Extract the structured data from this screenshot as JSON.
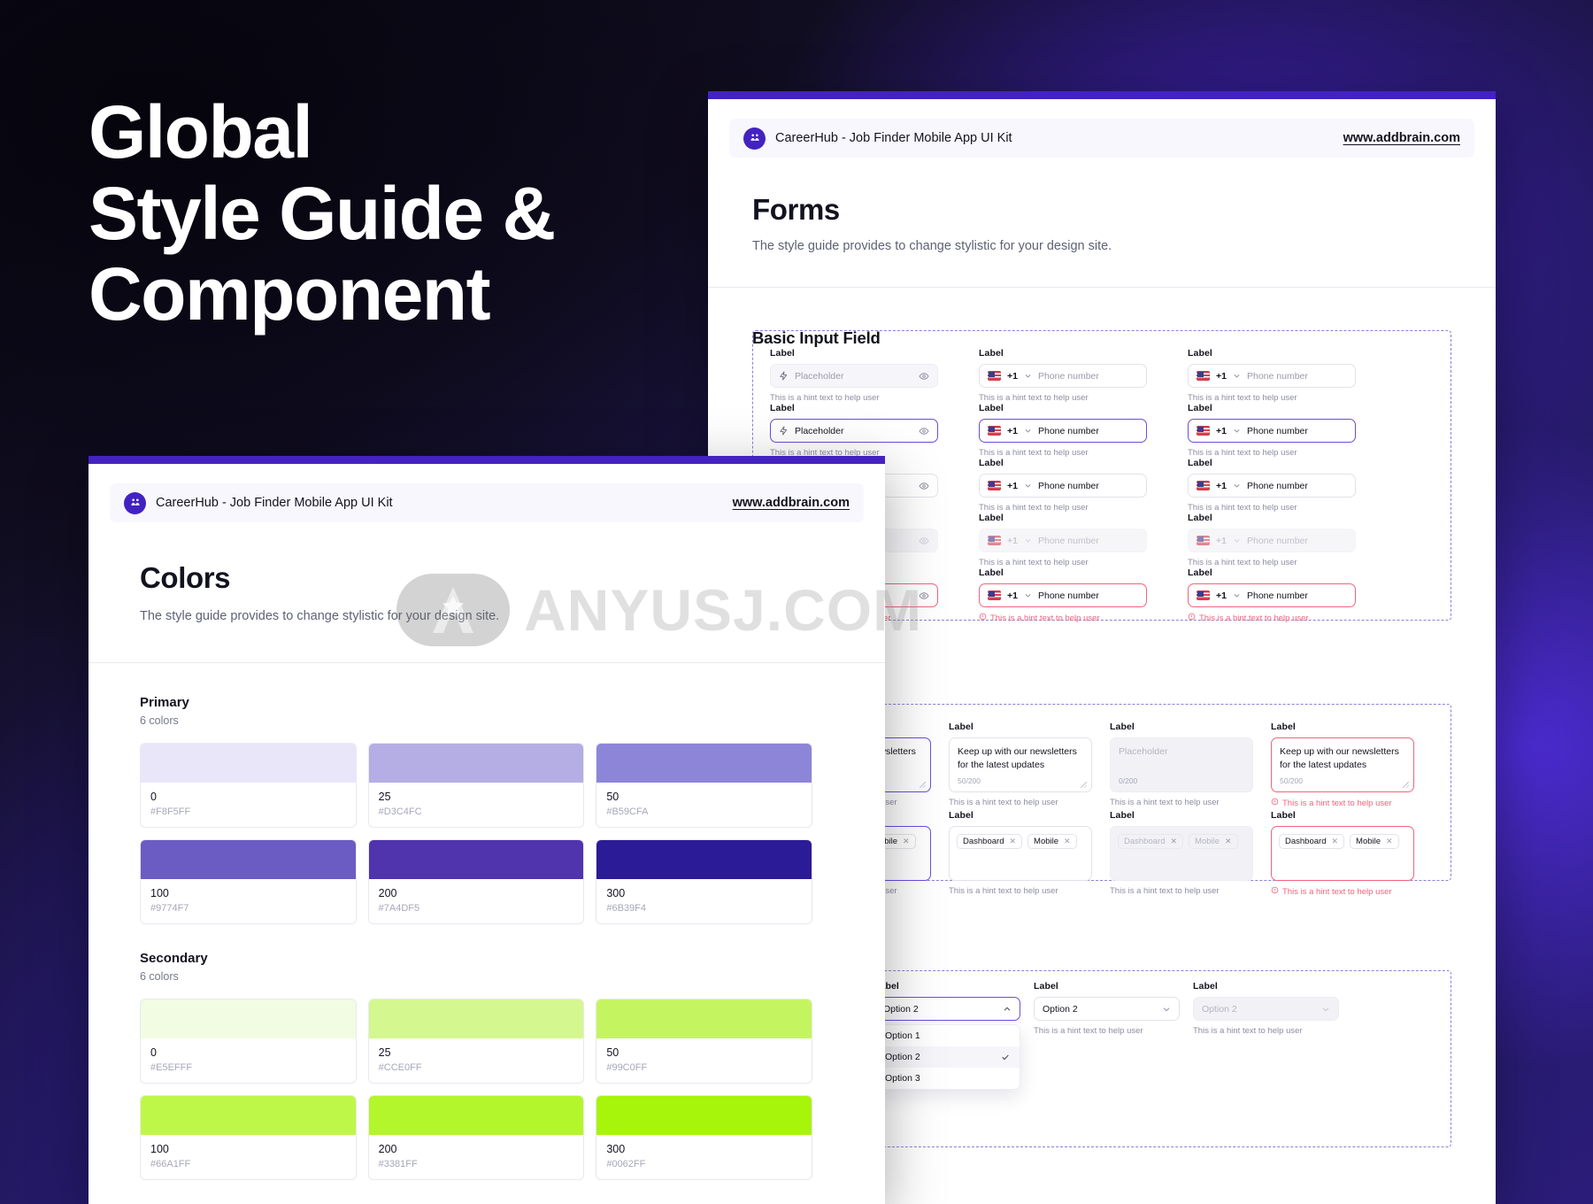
{
  "hero": {
    "line1": "Global",
    "line2": "Style Guide &",
    "line3": "Component"
  },
  "watermark": {
    "text": "ANYUSJ.COM",
    "logo_icon": "star-a-logo-icon"
  },
  "kit_header": {
    "title": "CareerHub - Job Finder Mobile App UI Kit",
    "url": "www.addbrain.com",
    "logo_icon": "careerhub-logo-icon"
  },
  "forms": {
    "title": "Forms",
    "subtitle": "The style guide provides to change stylistic for your design site.",
    "section_basic_input": "Basic Input Field",
    "label": "Label",
    "hint": "This is a hint text to help user",
    "placeholder": "Placeholder",
    "phone_placeholder": "Phone number",
    "country_code": "+1",
    "flag_icon": "us-flag-icon",
    "lightning_icon": "lightning-bolt-icon",
    "eye_icon": "eye-icon",
    "chevron_down_icon": "chevron-down-icon",
    "chevron_up_icon": "chevron-up-icon",
    "error_icon": "error-circle-icon",
    "check_icon": "check-icon",
    "textarea": {
      "value": "Keep up with our newsletters for the latest updates",
      "counter_filled": "50/200",
      "counter_empty": "0/200",
      "placeholder": "Placeholder"
    },
    "chips": [
      {
        "label": "Dashboard"
      },
      {
        "label": "Mobile"
      }
    ],
    "select": {
      "value": "Option 2",
      "options": [
        "Option 1",
        "Option 2",
        "Option 3"
      ],
      "selected": "Option 2"
    }
  },
  "colors": {
    "title": "Colors",
    "subtitle": "The style guide provides to change stylistic for your design site.",
    "palettes": [
      {
        "name": "Primary",
        "count": "6 colors",
        "swatches": [
          {
            "step": "0",
            "hex": "#F8F5FF",
            "swatch": "#EAE6FA"
          },
          {
            "step": "25",
            "hex": "#D3C4FC",
            "swatch": "#B5AEE4"
          },
          {
            "step": "50",
            "hex": "#B59CFA",
            "swatch": "#8D86D8"
          },
          {
            "step": "100",
            "hex": "#9774F7",
            "swatch": "#6B5CC4"
          },
          {
            "step": "200",
            "hex": "#7A4DF5",
            "swatch": "#4F34AE"
          },
          {
            "step": "300",
            "hex": "#6B39F4",
            "swatch": "#2B1B96"
          }
        ]
      },
      {
        "name": "Secondary",
        "count": "6 colors",
        "swatches": [
          {
            "step": "0",
            "hex": "#E5EFFF",
            "swatch": "#F2FCE2"
          },
          {
            "step": "25",
            "hex": "#CCE0FF",
            "swatch": "#D4F78F"
          },
          {
            "step": "50",
            "hex": "#99C0FF",
            "swatch": "#C4F561"
          },
          {
            "step": "100",
            "hex": "#66A1FF",
            "swatch": "#BFF749"
          },
          {
            "step": "200",
            "hex": "#3381FF",
            "swatch": "#B3F62B"
          },
          {
            "step": "300",
            "hex": "#0062FF",
            "swatch": "#A6F50A"
          }
        ]
      }
    ]
  },
  "accent": {
    "primary": "#4322C2",
    "error": "#F2647C"
  }
}
